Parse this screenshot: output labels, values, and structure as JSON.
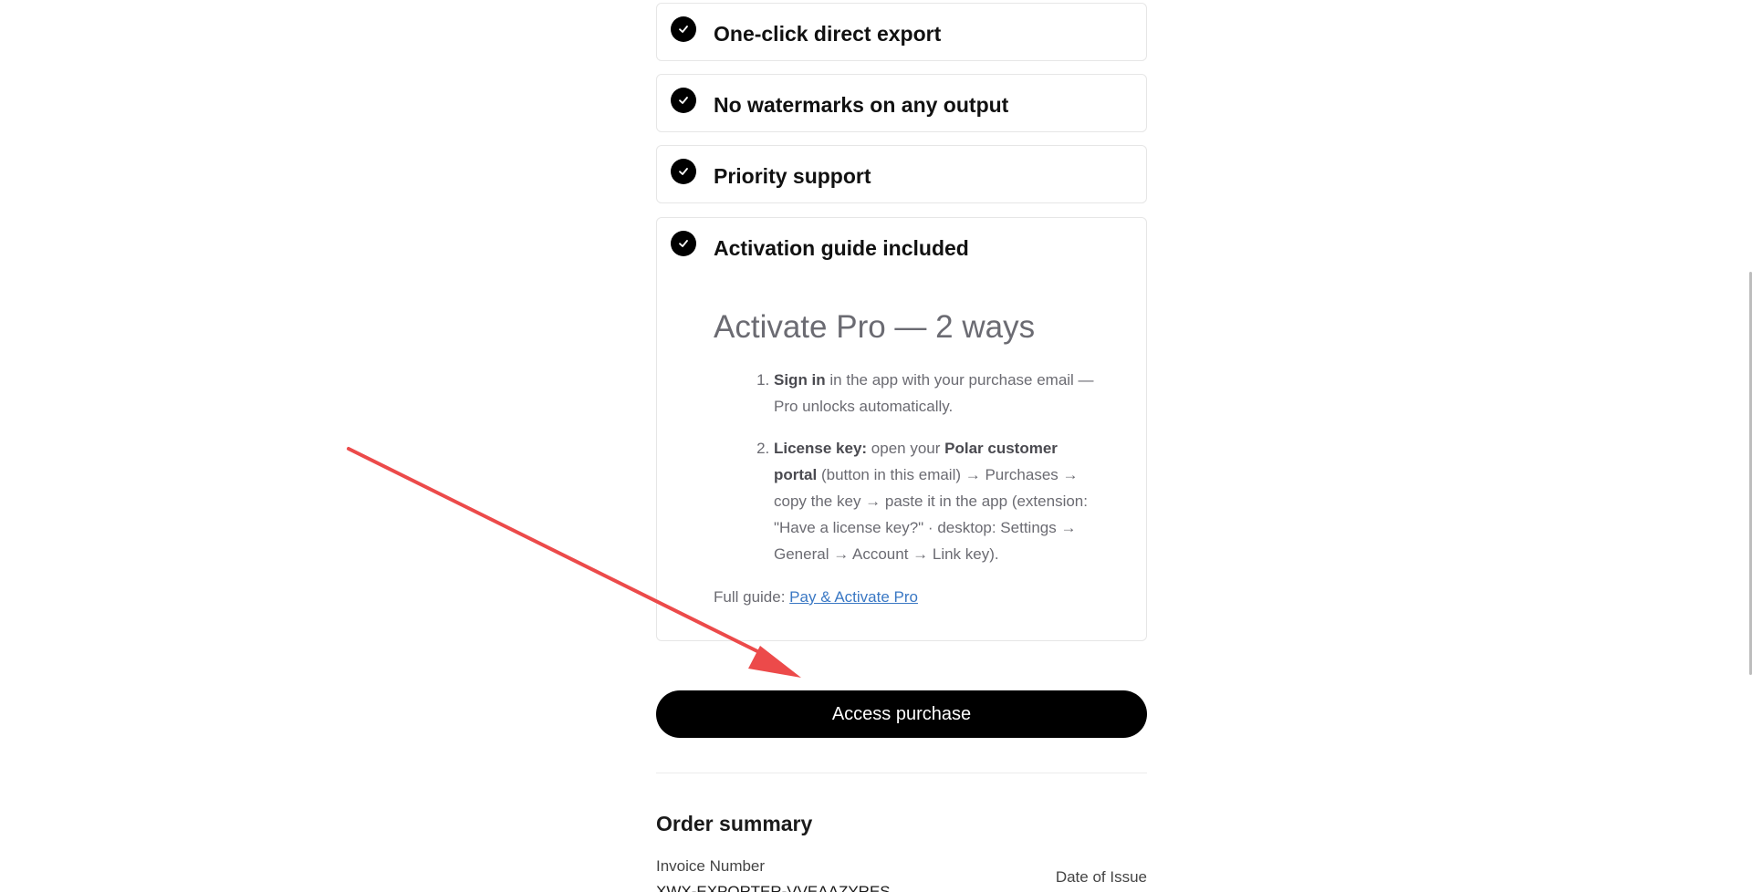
{
  "features": [
    {
      "title": "One-click direct export"
    },
    {
      "title": "No watermarks on any output"
    },
    {
      "title": "Priority support"
    },
    {
      "title": "Activation guide included"
    }
  ],
  "guide": {
    "heading": "Activate Pro — 2 ways",
    "step1_bold": "Sign in",
    "step1_text": " in the app with your purchase email — Pro unlocks automatically.",
    "step2_bold1": "License key:",
    "step2_text1": " open your ",
    "step2_bold2": "Polar customer portal",
    "step2_text2": " (button in this email) → Purchases → copy the key → paste it in the app (extension: \"Have a license key?\" · desktop: Settings → General → Account → Link key).",
    "full_guide_label": "Full guide: ",
    "full_guide_link": "Pay & Activate Pro"
  },
  "access_button_label": "Access purchase",
  "order_summary": {
    "title": "Order summary",
    "invoice_label": "Invoice Number",
    "invoice_value": "XWX-EXPORTER-VVEAAZYRES",
    "date_label": "Date of Issue"
  },
  "colors": {
    "accent_link": "#3a78c4",
    "arrow": "#ec4a4a",
    "button_bg": "#000000"
  },
  "icons": {
    "check": "check-circle-icon",
    "arrow": "red-arrow-annotation"
  }
}
